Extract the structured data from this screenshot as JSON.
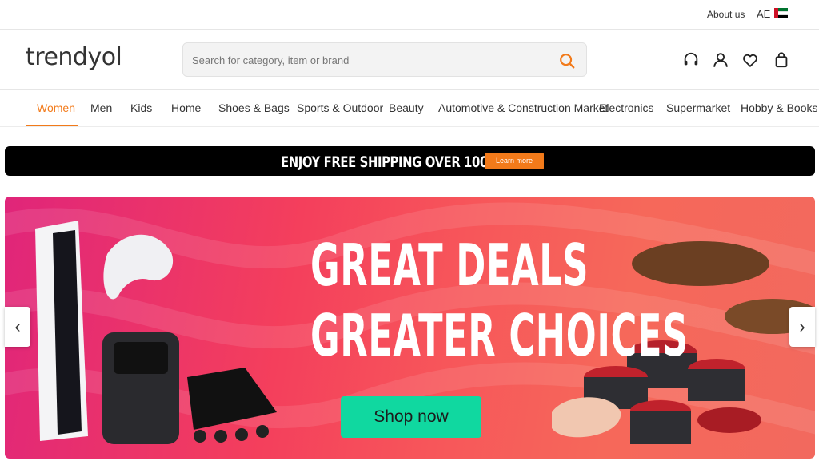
{
  "topbar": {
    "about": "About us",
    "lang": "AE"
  },
  "header": {
    "logo": "trendyol",
    "search_placeholder": "Search for category, item or brand",
    "icons": [
      "support-icon",
      "user-icon",
      "heart-icon",
      "bag-icon"
    ]
  },
  "nav": {
    "items": [
      "Women",
      "Men",
      "Kids",
      "Home",
      "Shoes & Bags",
      "Sports & Outdoor",
      "Beauty",
      "Automotive & Construction Market",
      "Electronics",
      "Supermarket",
      "Hobby & Books & St"
    ],
    "active": "Women"
  },
  "shipping": {
    "text": "ENJOY FREE SHIPPING OVER 100 AED",
    "button": "Learn more"
  },
  "hero": {
    "line1": "GREAT DEALS",
    "line2": "GREATER CHOICES",
    "button": "Shop now"
  },
  "arrows": {
    "prev": "‹",
    "next": "›"
  },
  "colors": {
    "brand": "#f27a1a",
    "cta": "#10d8a0",
    "banner_bg": "#f43f5c"
  }
}
